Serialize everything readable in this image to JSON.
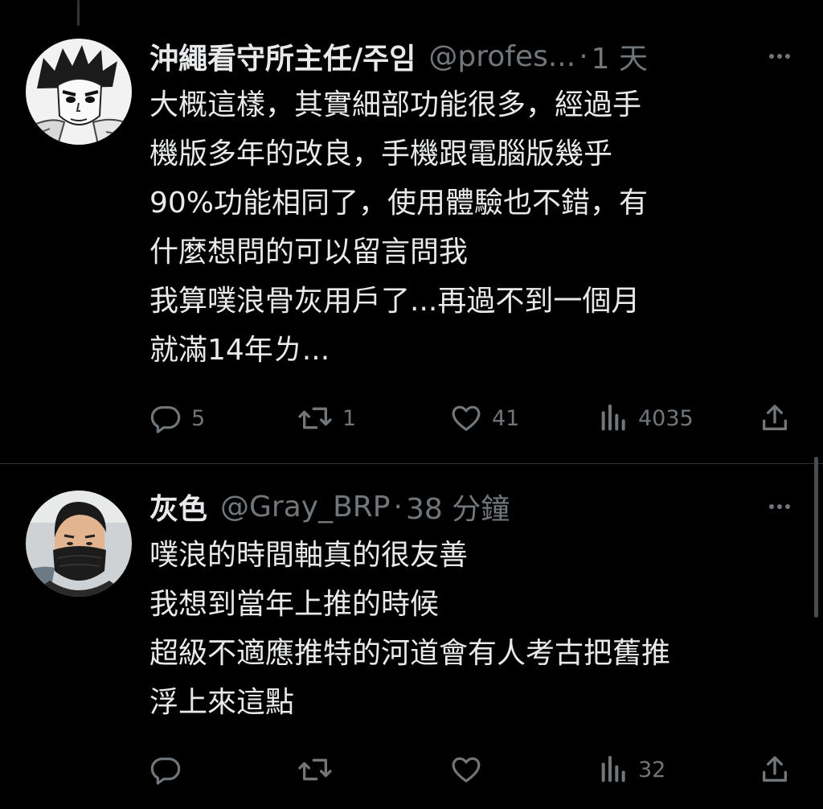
{
  "tweets": [
    {
      "name": "沖繩看守所主任/주임",
      "handle": "@profes...",
      "separator": "·",
      "time": "1 天",
      "lines": [
        "大概這樣，其實細部功能很多，經過手",
        "機版多年的改良，手機跟電腦版幾乎",
        "90%功能相同了，使用體驗也不錯，有",
        "什麼想問的可以留言問我",
        "我算噗浪骨灰用戶了...再過不到一個月",
        "就滿14年ㄌ..."
      ],
      "replies": "5",
      "retweets": "1",
      "likes": "41",
      "views": "4035",
      "avatar_icon": "manga-character-avatar-icon"
    },
    {
      "name": "灰色",
      "handle": "@Gray_BRP",
      "separator": "·",
      "time": "38 分鐘",
      "lines": [
        "噗浪的時間軸真的很友善",
        "我想到當年上推的時候",
        "超級不適應推特的河道會有人考古把舊推",
        "浮上來這點"
      ],
      "replies": "",
      "retweets": "",
      "likes": "",
      "views": "32",
      "avatar_icon": "person-with-mask-avatar-icon"
    }
  ],
  "colors": {
    "background": "#000000",
    "text": "#e7e9ea",
    "muted": "#71767b",
    "divider": "#2f3336"
  }
}
